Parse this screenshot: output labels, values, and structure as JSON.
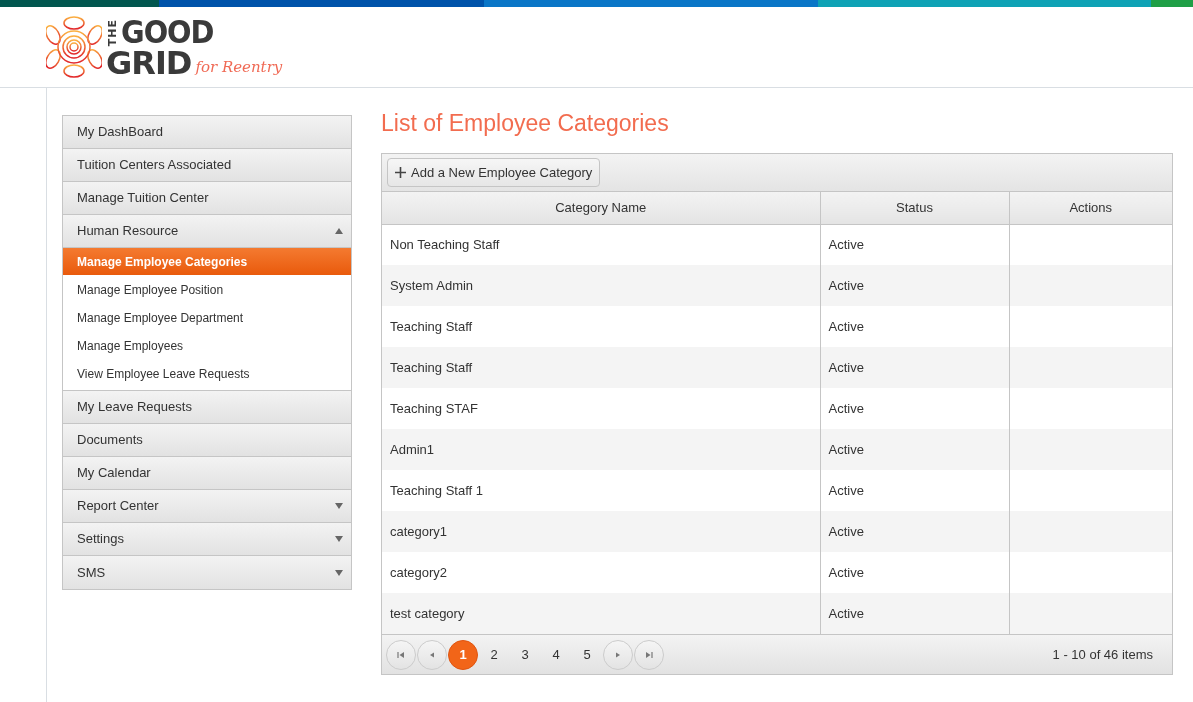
{
  "logo": {
    "word_1": "THE",
    "word_2": "GOOD",
    "word_3": "GRID",
    "tagline": "for Reentry"
  },
  "sidebar": {
    "items": [
      {
        "label": "My DashBoard"
      },
      {
        "label": "Tuition Centers Associated"
      },
      {
        "label": "Manage Tuition Center"
      },
      {
        "label": "Human Resource",
        "expanded": true,
        "children": [
          {
            "label": "Manage Employee Categories",
            "selected": true
          },
          {
            "label": "Manage Employee Position",
            "selected": false
          },
          {
            "label": "Manage Employee Department",
            "selected": false
          },
          {
            "label": "Manage Employees",
            "selected": false
          },
          {
            "label": "View Employee Leave Requests",
            "selected": false
          }
        ]
      },
      {
        "label": "My Leave Requests"
      },
      {
        "label": "Documents"
      },
      {
        "label": "My Calendar"
      },
      {
        "label": "Report Center",
        "expanded": false
      },
      {
        "label": "Settings",
        "expanded": false
      },
      {
        "label": "SMS",
        "expanded": false
      }
    ]
  },
  "page_title": "List of Employee Categories",
  "toolbar": {
    "add_button": "Add a New Employee Category"
  },
  "table": {
    "columns": [
      "Category Name",
      "Status",
      "Actions"
    ],
    "rows": [
      [
        "Non Teaching Staff",
        "Active",
        ""
      ],
      [
        "System Admin",
        "Active",
        ""
      ],
      [
        "Teaching Staff",
        "Active",
        ""
      ],
      [
        "Teaching Staff",
        "Active",
        ""
      ],
      [
        "Teaching STAF",
        "Active",
        ""
      ],
      [
        "Admin1",
        "Active",
        ""
      ],
      [
        "Teaching Staff 1",
        "Active",
        ""
      ],
      [
        "category1",
        "Active",
        ""
      ],
      [
        "category2",
        "Active",
        ""
      ],
      [
        "test category",
        "Active",
        ""
      ]
    ]
  },
  "pager": {
    "pages": [
      {
        "label": "1",
        "selected": true
      },
      {
        "label": "2",
        "selected": false
      },
      {
        "label": "3",
        "selected": false
      },
      {
        "label": "4",
        "selected": false
      },
      {
        "label": "5",
        "selected": false
      }
    ],
    "summary": "1 - 10 of 46 items"
  }
}
